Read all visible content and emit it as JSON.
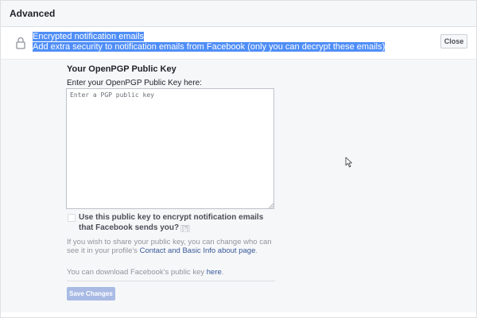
{
  "section": {
    "title": "Advanced"
  },
  "setting": {
    "icon": "lock-icon",
    "title": "Encrypted notification emails",
    "description": "Add extra security to notification emails from Facebook (only you can decrypt these emails)",
    "close_label": "Close"
  },
  "pgp": {
    "heading": "Your OpenPGP Public Key",
    "field_label": "Enter your OpenPGP Public Key here:",
    "field_value": "",
    "field_placeholder": "Enter a PGP public key",
    "checkbox_label": "Use this public key to encrypt notification emails that Facebook sends you?",
    "checkbox_checked": false,
    "help_marker": "[?]",
    "share_text_prefix": "If you wish to share your public key, you can change who can see it in your profile's ",
    "share_link": "Contact and Basic Info about page",
    "share_text_suffix": ".",
    "download_prefix": "You can download Facebook's public key ",
    "download_link": "here",
    "download_suffix": ".",
    "save_label": "Save Changes"
  },
  "colors": {
    "highlight": "#4f8ef7",
    "link": "#385898",
    "save_button_disabled": "#a9bbe4",
    "panel_background": "#f6f7f9"
  }
}
